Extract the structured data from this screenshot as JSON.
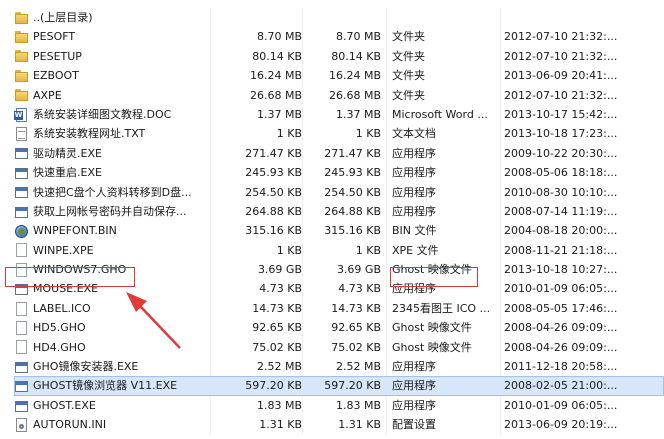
{
  "colors": {
    "selected_bg": "#d7e7fa",
    "annotation": "#d23a3a"
  },
  "files": [
    {
      "icon": "folder",
      "name": "..(上层目录)",
      "size": "",
      "packed": "",
      "type": "",
      "date": ""
    },
    {
      "icon": "folder",
      "name": "PESOFT",
      "size": "8.70 MB",
      "packed": "8.70 MB",
      "type": "文件夹",
      "date": "2012-07-10 21:32:..."
    },
    {
      "icon": "folder",
      "name": "PESETUP",
      "size": "80.14 KB",
      "packed": "80.14 KB",
      "type": "文件夹",
      "date": "2012-07-10 21:32:..."
    },
    {
      "icon": "folder",
      "name": "EZBOOT",
      "size": "16.24 MB",
      "packed": "16.24 MB",
      "type": "文件夹",
      "date": "2013-06-09 20:41:..."
    },
    {
      "icon": "folder",
      "name": "AXPE",
      "size": "26.68 MB",
      "packed": "26.68 MB",
      "type": "文件夹",
      "date": "2012-07-10 21:32:..."
    },
    {
      "icon": "doc",
      "name": "系统安装详细图文教程.DOC",
      "size": "1.37 MB",
      "packed": "1.37 MB",
      "type": "Microsoft Word ...",
      "date": "2013-10-17 15:42:..."
    },
    {
      "icon": "txt",
      "name": "系统安装教程网址.TXT",
      "size": "1 KB",
      "packed": "1 KB",
      "type": "文本文档",
      "date": "2013-10-18 17:23:..."
    },
    {
      "icon": "exe",
      "name": "驱动精灵.EXE",
      "size": "271.47 KB",
      "packed": "271.47 KB",
      "type": "应用程序",
      "date": "2009-10-22 20:30:..."
    },
    {
      "icon": "exe",
      "name": "快速重启.EXE",
      "size": "245.93 KB",
      "packed": "245.93 KB",
      "type": "应用程序",
      "date": "2008-05-06 18:18:..."
    },
    {
      "icon": "exe",
      "name": "快速把C盘个人资料转移到D盘...",
      "size": "254.50 KB",
      "packed": "254.50 KB",
      "type": "应用程序",
      "date": "2010-08-30 10:10:..."
    },
    {
      "icon": "exe",
      "name": "获取上网帐号密码并自动保存...",
      "size": "264.88 KB",
      "packed": "264.88 KB",
      "type": "应用程序",
      "date": "2008-07-14 11:19:..."
    },
    {
      "icon": "font",
      "name": "WNPEFONT.BIN",
      "size": "315.16 KB",
      "packed": "315.16 KB",
      "type": "BIN 文件",
      "date": "2004-08-18 20:00:..."
    },
    {
      "icon": "file",
      "name": "WINPE.XPE",
      "size": "1 KB",
      "packed": "1 KB",
      "type": "XPE 文件",
      "date": "2008-11-21 21:18:..."
    },
    {
      "icon": "file",
      "name": "WINDOWS7.GHO",
      "size": "3.69 GB",
      "packed": "3.69 GB",
      "type": "Ghost 映像文件",
      "date": "2013-10-18 10:27:..."
    },
    {
      "icon": "exe",
      "name": "MOUSE.EXE",
      "size": "4.73 KB",
      "packed": "4.73 KB",
      "type": "应用程序",
      "date": "2010-01-09 06:05:..."
    },
    {
      "icon": "file",
      "name": "LABEL.ICO",
      "size": "14.73 KB",
      "packed": "14.73 KB",
      "type": "2345看图王 ICO ...",
      "date": "2008-05-05 17:46:..."
    },
    {
      "icon": "file",
      "name": "HD5.GHO",
      "size": "92.65 KB",
      "packed": "92.65 KB",
      "type": "Ghost 映像文件",
      "date": "2008-04-26 09:09:..."
    },
    {
      "icon": "file",
      "name": "HD4.GHO",
      "size": "75.02 KB",
      "packed": "75.02 KB",
      "type": "Ghost 映像文件",
      "date": "2008-04-26 09:09:..."
    },
    {
      "icon": "exe",
      "name": "GHO镜像安装器.EXE",
      "size": "2.52 MB",
      "packed": "2.52 MB",
      "type": "应用程序",
      "date": "2011-12-18 20:58:..."
    },
    {
      "icon": "exe",
      "name": "GHOST镜像浏览器 V11.EXE",
      "size": "597.20 KB",
      "packed": "597.20 KB",
      "type": "应用程序",
      "date": "2008-02-05 21:00:...",
      "selected": true
    },
    {
      "icon": "exe",
      "name": "GHOST.EXE",
      "size": "1.83 MB",
      "packed": "1.83 MB",
      "type": "应用程序",
      "date": "2010-01-09 06:05:..."
    },
    {
      "icon": "ini",
      "name": "AUTORUN.INI",
      "size": "1.31 KB",
      "packed": "1.31 KB",
      "type": "配置设置",
      "date": "2013-06-09 20:19:..."
    }
  ]
}
